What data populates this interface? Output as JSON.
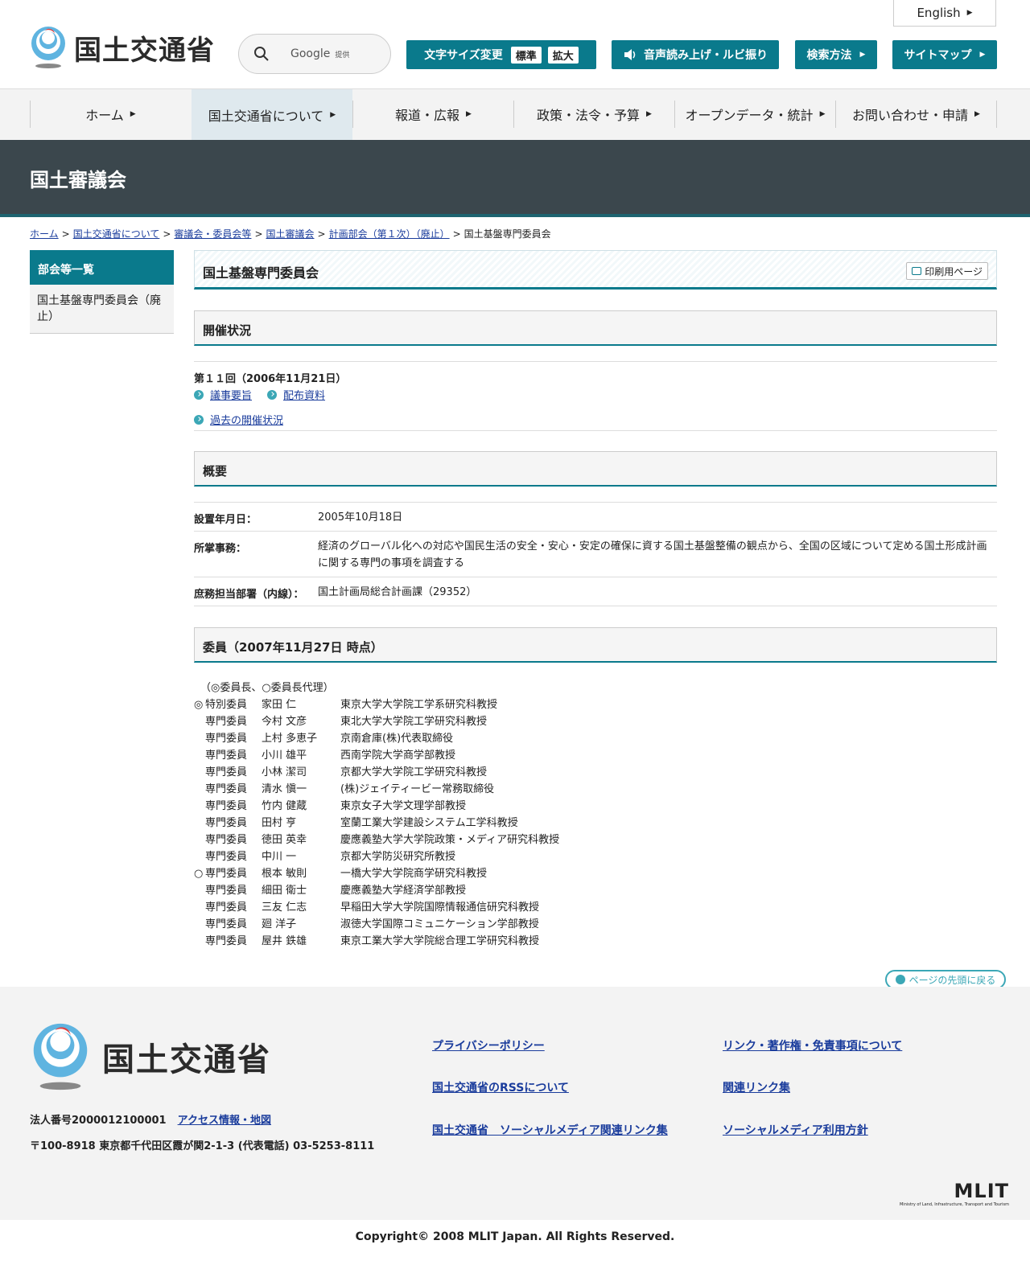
{
  "header": {
    "logo_text": "国土交通省",
    "search": {
      "label": "Google",
      "sub": "提供"
    },
    "english": "English",
    "font_size": {
      "label": "文字サイズ変更",
      "standard": "標準",
      "large": "拡大"
    },
    "voice": "音声読み上げ・ルビ振り",
    "howto": "検索方法",
    "sitemap": "サイトマップ"
  },
  "gnav": [
    "ホーム",
    "国土交通省について",
    "報道・広報",
    "政策・法令・予算",
    "オープンデータ・統計",
    "お問い合わせ・申請"
  ],
  "title_band": "国土審議会",
  "breadcrumb": {
    "links": [
      "ホーム",
      "国土交通省について",
      "審議会・委員会等",
      "国土審議会",
      "計画部会（第１次）（廃止）"
    ],
    "current": "国土基盤専門委員会"
  },
  "sidebar": {
    "heading": "部会等一覧",
    "item": "国土基盤専門委員会（廃止）"
  },
  "page_title": "国土基盤専門委員会",
  "print_label": "印刷用ページ",
  "status": {
    "heading": "開催状況",
    "session": "第１１回（2006年11月21日）",
    "links": [
      "議事要旨",
      "配布資料"
    ],
    "past": "過去の開催状況"
  },
  "overview": {
    "heading": "概要",
    "rows": [
      {
        "label": "設置年月日：",
        "value": "2005年10月18日"
      },
      {
        "label": "所掌事務：",
        "value": "経済のグローバル化への対応や国民生活の安全・安心・安定の確保に資する国土基盤整備の観点から、全国の区域について定める国土形成計画に関する専門の事項を調査する"
      },
      {
        "label": "庶務担当部署（内線）：",
        "value": "国土計画局総合計画課（29352）"
      }
    ]
  },
  "members": {
    "heading": "委員（2007年11月27日 時点）",
    "note": "（◎委員長、○委員長代理）",
    "list": [
      {
        "mark": "◎",
        "role": "特別委員",
        "name": "家田 仁",
        "org": "東京大学大学院工学系研究科教授"
      },
      {
        "mark": "",
        "role": "専門委員",
        "name": "今村 文彦",
        "org": "東北大学大学院工学研究科教授"
      },
      {
        "mark": "",
        "role": "専門委員",
        "name": "上村 多恵子",
        "org": "京南倉庫(株)代表取締役"
      },
      {
        "mark": "",
        "role": "専門委員",
        "name": "小川 雄平",
        "org": "西南学院大学商学部教授"
      },
      {
        "mark": "",
        "role": "専門委員",
        "name": "小林 潔司",
        "org": "京都大学大学院工学研究科教授"
      },
      {
        "mark": "",
        "role": "専門委員",
        "name": "清水 愼一",
        "org": "(株)ジェイティービー常務取締役"
      },
      {
        "mark": "",
        "role": "専門委員",
        "name": "竹内 健蔵",
        "org": "東京女子大学文理学部教授"
      },
      {
        "mark": "",
        "role": "専門委員",
        "name": "田村 亨",
        "org": "室蘭工業大学建設システム工学科教授"
      },
      {
        "mark": "",
        "role": "専門委員",
        "name": "徳田 英幸",
        "org": "慶應義塾大学大学院政策・メディア研究科教授"
      },
      {
        "mark": "",
        "role": "専門委員",
        "name": "中川 一",
        "org": "京都大学防災研究所教授"
      },
      {
        "mark": "○",
        "role": "専門委員",
        "name": "根本 敏則",
        "org": "一橋大学大学院商学研究科教授"
      },
      {
        "mark": "",
        "role": "専門委員",
        "name": "細田 衛士",
        "org": "慶應義塾大学経済学部教授"
      },
      {
        "mark": "",
        "role": "専門委員",
        "name": "三友 仁志",
        "org": "早稲田大学大学院国際情報通信研究科教授"
      },
      {
        "mark": "",
        "role": "専門委員",
        "name": "廻 洋子",
        "org": "淑徳大学国際コミュニケーション学部教授"
      },
      {
        "mark": "",
        "role": "専門委員",
        "name": "屋井 鉄雄",
        "org": "東京工業大学大学院総合理工学研究科教授"
      }
    ]
  },
  "to_top": "ページの先頭に戻る",
  "footer": {
    "logo_text": "国土交通省",
    "corp_no": "法人番号2000012100001",
    "access": "アクセス情報・地図",
    "address": "〒100-8918 東京都千代田区霞が関2-1-3 (代表電話) 03-5253-8111",
    "links": [
      "プライバシーポリシー",
      "リンク・著作権・免責事項について",
      "国土交通省のRSSについて",
      "関連リンク集",
      "国土交通省　ソーシャルメディア関連リンク集",
      "ソーシャルメディア利用方針"
    ],
    "mlit": "MLIT",
    "mlit_sub": "Ministry of Land, Infrastructure, Transport and Tourism",
    "copyright": "Copyright© 2008 MLIT Japan. All Rights Reserved."
  },
  "colors": {
    "accent": "#0a7a8c",
    "band": "#3b474d",
    "link": "#1a3c9c"
  }
}
